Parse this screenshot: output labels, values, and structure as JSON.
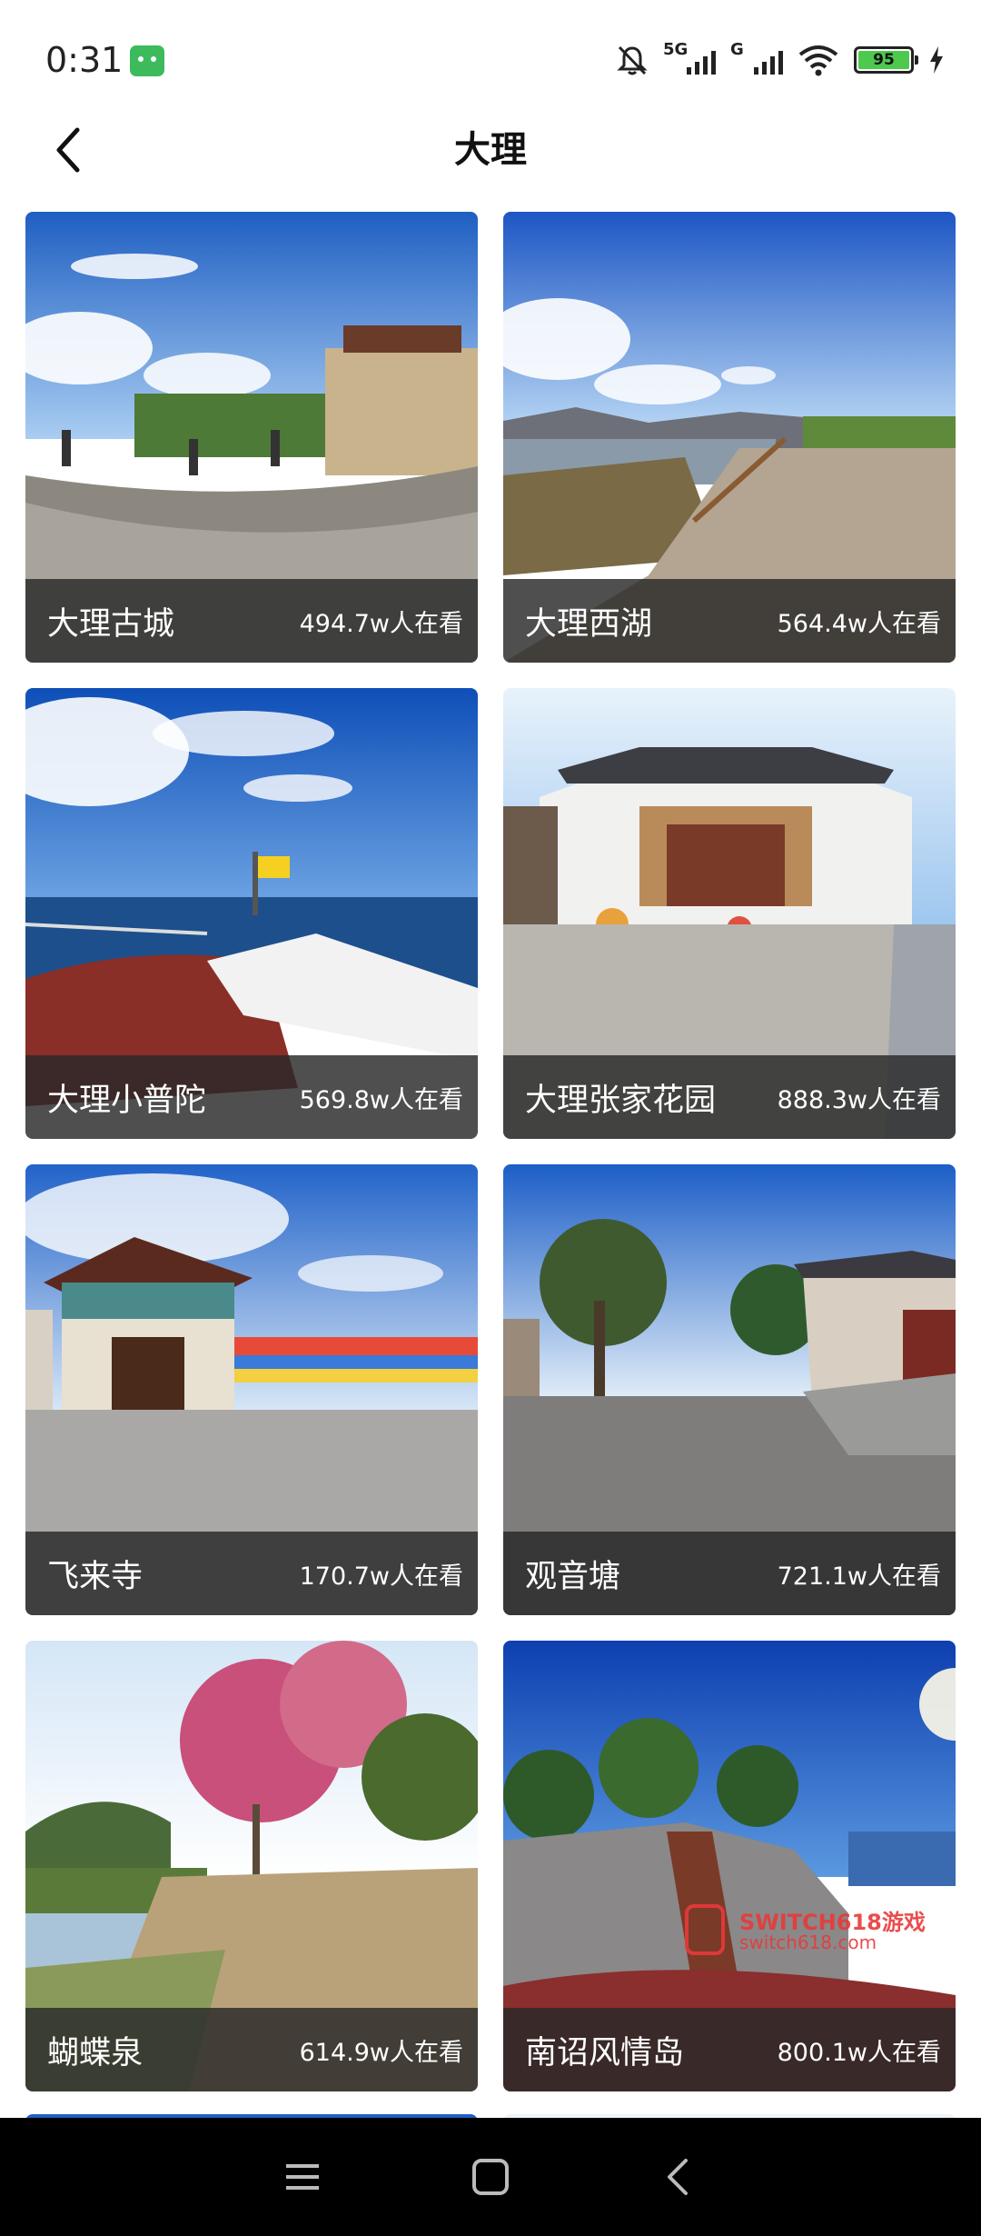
{
  "status_bar": {
    "time": "0:31",
    "network_1": "5G",
    "network_2": "G",
    "battery": "95"
  },
  "header": {
    "title": "大理"
  },
  "spots": [
    {
      "name": "大理古城",
      "views": "494.7w人在看"
    },
    {
      "name": "大理西湖",
      "views": "564.4w人在看"
    },
    {
      "name": "大理小普陀",
      "views": "569.8w人在看"
    },
    {
      "name": "大理张家花园",
      "views": "888.3w人在看"
    },
    {
      "name": "飞来寺",
      "views": "170.7w人在看"
    },
    {
      "name": "观音塘",
      "views": "721.1w人在看"
    },
    {
      "name": "蝴蝶泉",
      "views": "614.9w人在看"
    },
    {
      "name": "南诏风情岛",
      "views": "800.1w人在看"
    }
  ],
  "watermark": {
    "line1": "SWITCH618游戏",
    "line2": "switch618.com"
  },
  "icons": {
    "back": "chevron-left-icon",
    "menu": "menu-icon",
    "home": "square-icon",
    "nav_back": "triangle-back-icon"
  },
  "colors": {
    "caption_bg": "#282828",
    "nav_bg": "#000000",
    "battery_fill": "#4dc94d"
  }
}
